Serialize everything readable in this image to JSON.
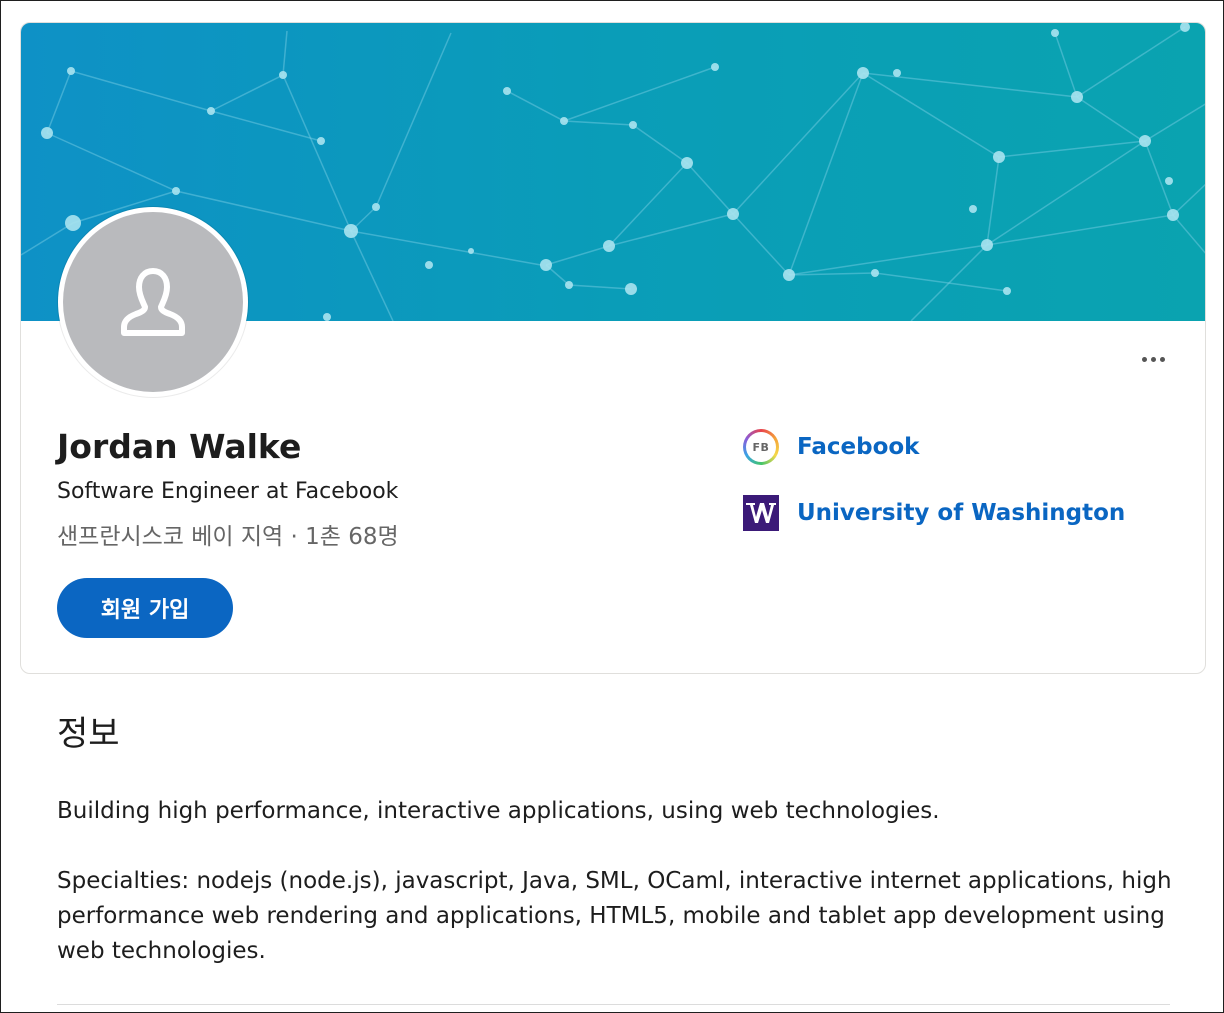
{
  "profile": {
    "name": "Jordan Walke",
    "headline": "Software Engineer at Facebook",
    "location": "샌프란시스코 베이 지역 · 1촌 68명",
    "join_label": "회원 가입"
  },
  "experience": {
    "company_logo_text": "FB",
    "company_name": "Facebook",
    "school_name": "University of Washington"
  },
  "about": {
    "title": "정보",
    "paragraphs": [
      "Building high performance, interactive applications, using web technologies.",
      "Specialties: nodejs (node.js), javascript, Java, SML, OCaml, interactive internet applications, high performance web rendering and applications, HTML5, mobile and tablet app development using web technologies."
    ]
  },
  "icons": {
    "avatar": "person-placeholder-icon",
    "more": "more-horizontal-icon",
    "school": "uw-logo-icon"
  },
  "colors": {
    "accent": "#0b66c2",
    "link": "#0a66c2",
    "banner": "#0a9db8",
    "school_logo": "#3b1a78"
  }
}
